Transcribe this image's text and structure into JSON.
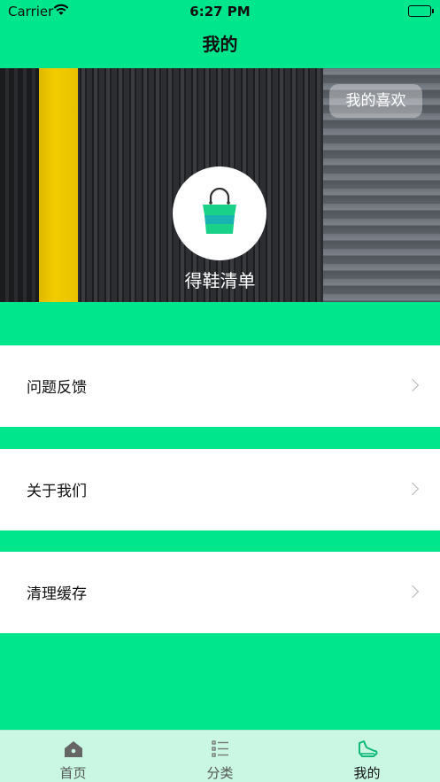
{
  "status_bar": {
    "carrier": "Carrier",
    "time": "6:27 PM"
  },
  "nav": {
    "title": "我的"
  },
  "hero": {
    "favorite_button": "我的喜欢",
    "shoe_list_label": "得鞋清单"
  },
  "menu": [
    {
      "label": "问题反馈"
    },
    {
      "label": "关于我们"
    },
    {
      "label": "清理缓存"
    }
  ],
  "tabs": [
    {
      "label": "首页",
      "icon": "home-icon",
      "active": false
    },
    {
      "label": "分类",
      "icon": "list-icon",
      "active": false
    },
    {
      "label": "我的",
      "icon": "shoe-icon",
      "active": true
    }
  ],
  "colors": {
    "accent": "#00e68c",
    "tab_bar_bg": "#c9f7e4",
    "bag_green": "#1ad18a",
    "bag_teal": "#18b3b0"
  }
}
